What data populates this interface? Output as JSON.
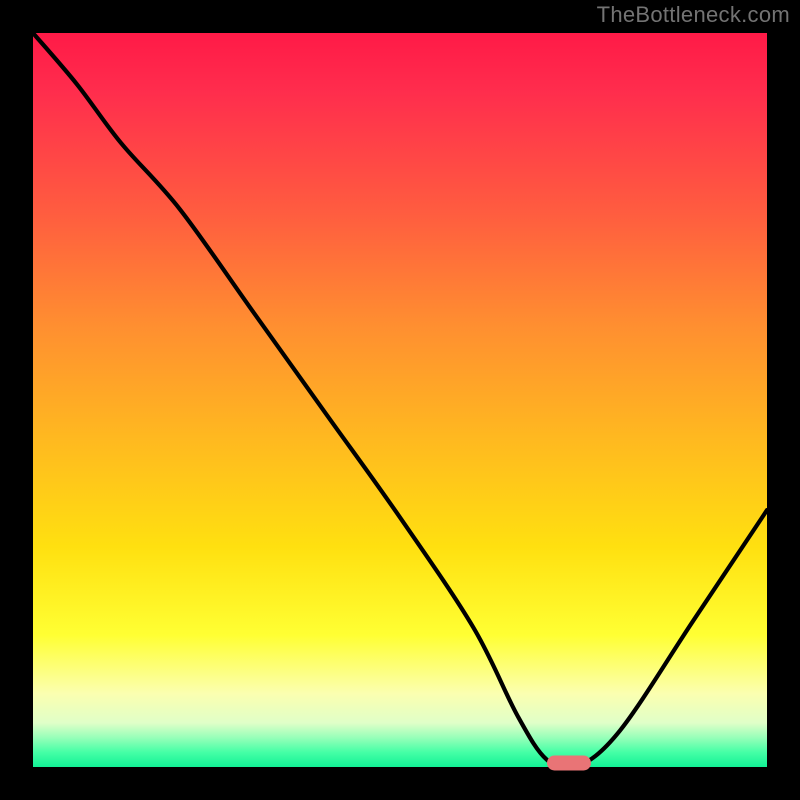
{
  "watermark": "TheBottleneck.com",
  "colors": {
    "page_bg": "#000000",
    "watermark": "#737373",
    "curve_stroke": "#000000",
    "marker_fill": "#e97476",
    "gradient_stops": [
      "#ff1a47",
      "#ff5e3f",
      "#ffb820",
      "#ffff33",
      "#fbffb0",
      "#12f296"
    ]
  },
  "chart_data": {
    "type": "line",
    "title": "",
    "xlabel": "",
    "ylabel": "",
    "xlim": [
      0,
      100
    ],
    "ylim": [
      0,
      100
    ],
    "grid": false,
    "legend": false,
    "series": [
      {
        "name": "bottleneck_curve",
        "comment": "Approximate reading: curve starts top-left at y=100, descends steeply, reaches minimum near x≈70 at y≈0, then rises to y≈35 at x=100.",
        "x": [
          0,
          6,
          12,
          20,
          30,
          40,
          50,
          60,
          66,
          70,
          74,
          80,
          90,
          100
        ],
        "values": [
          100,
          93,
          85,
          76,
          62,
          48,
          34,
          19,
          7,
          1,
          0,
          5,
          20,
          35
        ]
      }
    ],
    "marker": {
      "name": "optimal_point",
      "x": 73,
      "y": 0.5,
      "shape": "rounded_bar",
      "color": "#e97476"
    },
    "background": {
      "type": "vertical_gradient",
      "meaning": "red=high bottleneck, green=low bottleneck",
      "top": "red",
      "bottom": "green"
    }
  }
}
